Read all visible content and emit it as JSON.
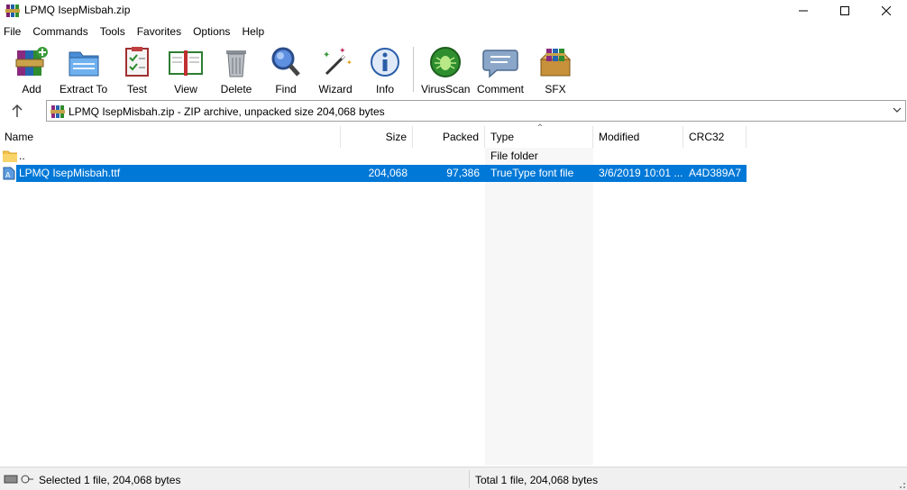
{
  "window": {
    "title": "LPMQ IsepMisbah.zip",
    "controls": {
      "minimize": "minimize",
      "maximize": "maximize",
      "close": "close"
    }
  },
  "menu": [
    "File",
    "Commands",
    "Tools",
    "Favorites",
    "Options",
    "Help"
  ],
  "toolbar": {
    "buttons": [
      {
        "label": "Add",
        "icon": "add-archive-icon"
      },
      {
        "label": "Extract To",
        "icon": "extract-folder-icon"
      },
      {
        "label": "Test",
        "icon": "test-clipboard-icon"
      },
      {
        "label": "View",
        "icon": "view-book-icon"
      },
      {
        "label": "Delete",
        "icon": "trash-bin-icon"
      },
      {
        "label": "Find",
        "icon": "magnifier-icon"
      },
      {
        "label": "Wizard",
        "icon": "magic-wand-icon"
      },
      {
        "label": "Info",
        "icon": "info-icon"
      },
      {
        "label": "VirusScan",
        "icon": "virus-scan-icon"
      },
      {
        "label": "Comment",
        "icon": "comment-icon"
      },
      {
        "label": "SFX",
        "icon": "sfx-box-icon"
      }
    ]
  },
  "address": {
    "text": "LPMQ IsepMisbah.zip - ZIP archive, unpacked size 204,068 bytes"
  },
  "list": {
    "columns": [
      "Name",
      "Size",
      "Packed",
      "Type",
      "Modified",
      "CRC32"
    ],
    "sorted_by": "Type",
    "rows": [
      {
        "name": "..",
        "size": "",
        "packed": "",
        "type": "File folder",
        "modified": "",
        "crc": "",
        "selected": false,
        "icon": "folder-icon"
      },
      {
        "name": "LPMQ IsepMisbah.ttf",
        "size": "204,068",
        "packed": "97,386",
        "type": "TrueType font file",
        "modified": "3/6/2019 10:01 ...",
        "crc": "A4D389A7",
        "selected": true,
        "icon": "font-file-icon"
      }
    ]
  },
  "status": {
    "left": "Selected 1 file, 204,068 bytes",
    "right": "Total 1 file, 204,068 bytes"
  },
  "colors": {
    "selection": "#0078d7",
    "sorted_column": "#f7f7f7"
  }
}
